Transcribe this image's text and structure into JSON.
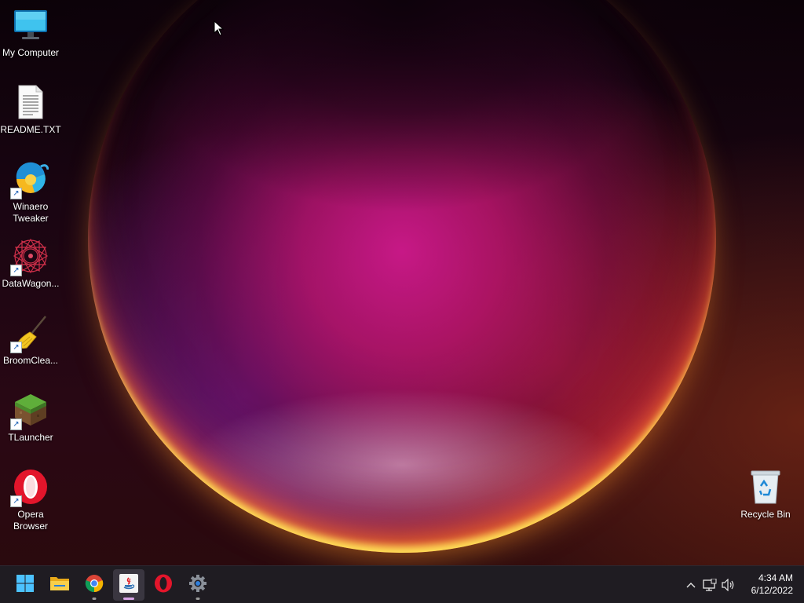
{
  "desktop_icons": [
    {
      "label": "My Computer",
      "icon": "monitor-icon"
    },
    {
      "label": "README.TXT",
      "icon": "text-document-icon"
    },
    {
      "label": "Winaero\nTweaker",
      "icon": "winaero-tweaker-icon",
      "shortcut": true
    },
    {
      "label": "DataWagon...",
      "icon": "datawagon-icon",
      "shortcut": true
    },
    {
      "label": "BroomClea...",
      "icon": "broom-icon",
      "shortcut": true
    },
    {
      "label": "TLauncher",
      "icon": "grass-block-icon",
      "shortcut": true
    },
    {
      "label": "Opera\nBrowser",
      "icon": "opera-icon",
      "shortcut": true
    },
    {
      "label": "Recycle Bin",
      "icon": "recycle-bin-icon"
    }
  ],
  "taskbar": {
    "apps": [
      {
        "name": "Start",
        "icon": "windows-start-icon"
      },
      {
        "name": "File Explorer",
        "icon": "folder-icon"
      },
      {
        "name": "Google Chrome",
        "icon": "chrome-icon",
        "running": true
      },
      {
        "name": "Java",
        "icon": "java-icon",
        "running": true,
        "active": true
      },
      {
        "name": "Opera",
        "icon": "opera-icon"
      },
      {
        "name": "Settings",
        "icon": "settings-gear-icon",
        "running": true
      }
    ],
    "tray": {
      "chevron": "^",
      "icons": [
        "network-icon",
        "volume-icon"
      ]
    },
    "clock": {
      "time": "4:34 AM",
      "date": "6/12/2022"
    }
  },
  "colors": {
    "taskbar_bg": "#1f1c22",
    "accent_active": "#d9a6e8"
  }
}
